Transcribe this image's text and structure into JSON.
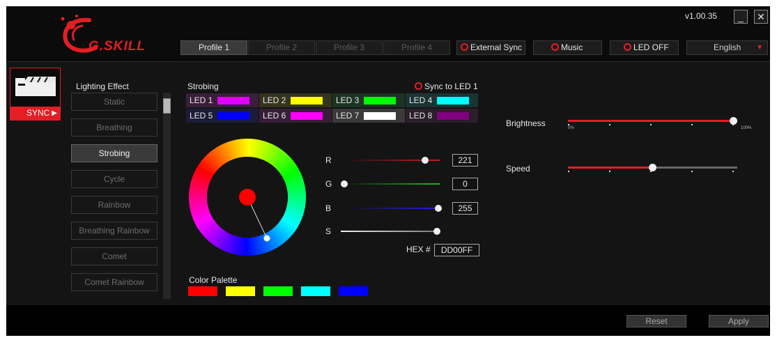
{
  "header": {
    "version": "v1.00.35",
    "logo_text": "G.SKILL",
    "minimize_label": "_",
    "close_label": "✕"
  },
  "profiles": [
    {
      "label": "Profile 1",
      "active": true
    },
    {
      "label": "Profile 2",
      "active": false
    },
    {
      "label": "Profile 3",
      "active": false
    },
    {
      "label": "Profile 4",
      "active": false
    }
  ],
  "toolbar": {
    "external_sync": "External Sync",
    "music": "Music",
    "led_off": "LED OFF",
    "language": "English"
  },
  "module": {
    "sync_label": "SYNC"
  },
  "lighting": {
    "title": "Lighting Effect",
    "effects": [
      "Static",
      "Breathing",
      "Strobing",
      "Cycle",
      "Rainbow",
      "Breathing Rainbow",
      "Comet",
      "Comet Rainbow"
    ],
    "active_effect": "Strobing"
  },
  "strobing": {
    "title": "Strobing",
    "sync_to_led": "Sync to LED 1",
    "leds": [
      {
        "label": "LED 1",
        "color": "#DD00FF",
        "bg": "#3a1f3a"
      },
      {
        "label": "LED 2",
        "color": "#FFFF00",
        "bg": "#34341f"
      },
      {
        "label": "LED 3",
        "color": "#00FF00",
        "bg": "#1c3421"
      },
      {
        "label": "LED 4",
        "color": "#00FFFF",
        "bg": "#1a3434"
      },
      {
        "label": "LED 5",
        "color": "#0000FF",
        "bg": "#1c1c3a"
      },
      {
        "label": "LED 6",
        "color": "#FF00FF",
        "bg": "#361f36"
      },
      {
        "label": "LED 7",
        "color": "#FFFFFF",
        "bg": "#3a3a3a"
      },
      {
        "label": "LED 8",
        "color": "#800080",
        "bg": "#2a1f2a"
      }
    ]
  },
  "color_picker": {
    "r_label": "R",
    "r_value": "221",
    "g_label": "G",
    "g_value": "0",
    "b_label": "B",
    "b_value": "255",
    "s_label": "S",
    "saturation": 1.0,
    "hex_label": "HEX #",
    "hex_value": "DD00FF"
  },
  "palette": {
    "title": "Color Palette",
    "colors": [
      "#FF0000",
      "#FFFF00",
      "#00FF00",
      "#00FFFF",
      "#0000FF"
    ]
  },
  "brightness": {
    "label": "Brightness",
    "value": 1.0,
    "min_label": "0%",
    "max_label": "100%"
  },
  "speed": {
    "label": "Speed",
    "value": 0.5
  },
  "footer": {
    "reset": "Reset",
    "apply": "Apply"
  },
  "colors": {
    "accent": "#E31E24"
  }
}
